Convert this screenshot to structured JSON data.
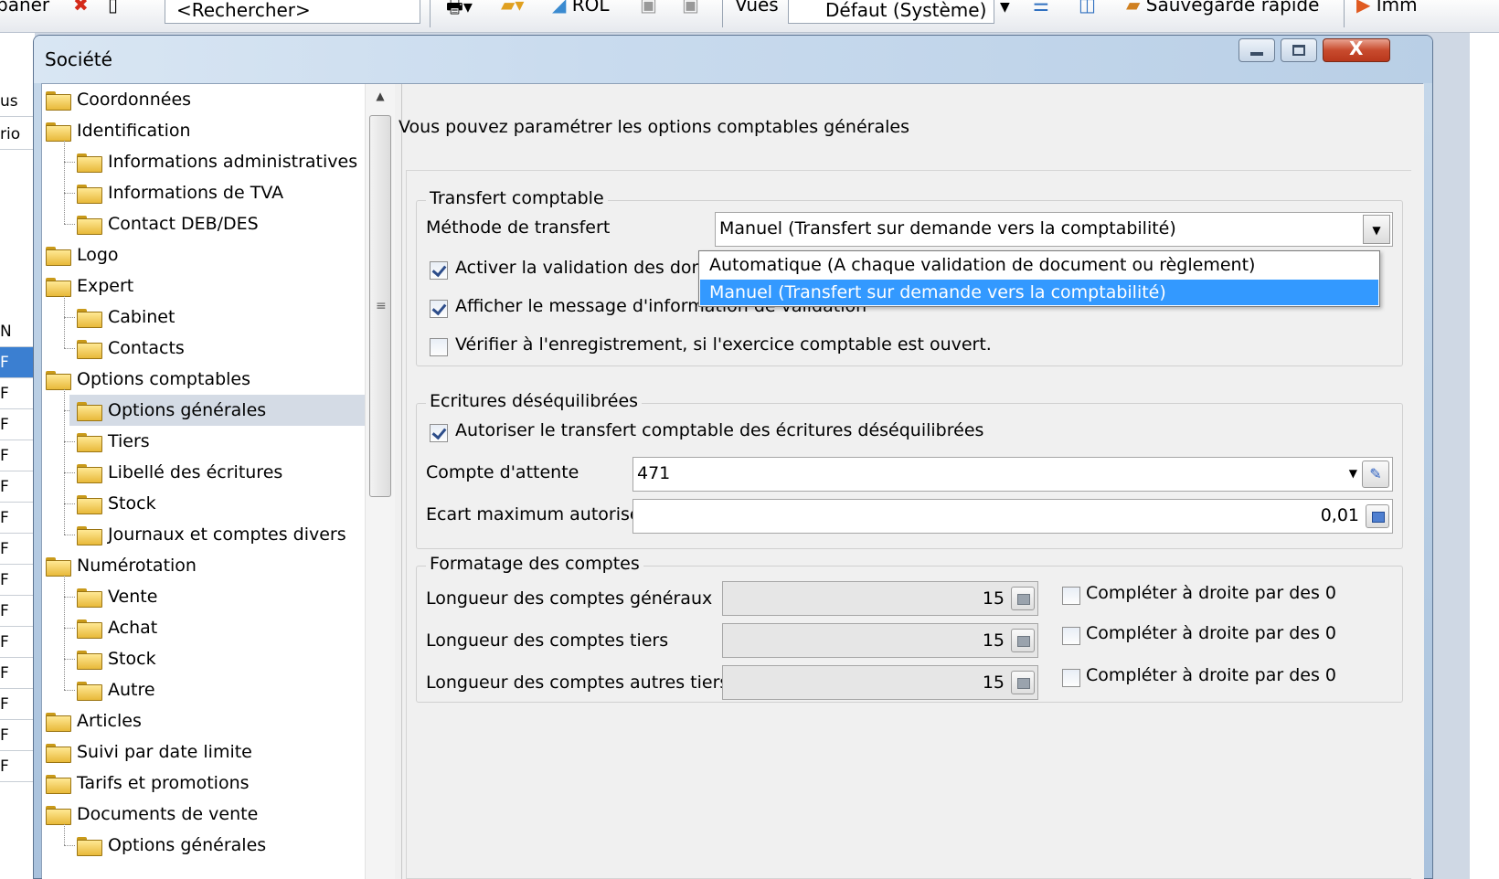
{
  "app_toolbar": {
    "frag_left": "baner",
    "search_placeholder": "<Rechercher>",
    "rol_label": "ROL",
    "views_label": "Vues",
    "views_value": "Défaut (Système)",
    "quick_save": "Sauvegarde rapide",
    "frag_right": "Imm"
  },
  "background": {
    "left_frags": [
      "us",
      "rio",
      "N",
      "F",
      "F",
      "F",
      "F",
      "F",
      "F",
      "F",
      "F",
      "F",
      "F",
      "F",
      "F",
      "F",
      "F"
    ]
  },
  "dialog": {
    "title": "Société",
    "tree": [
      {
        "label": "Coordonnées",
        "level": 0
      },
      {
        "label": "Identification",
        "level": 0
      },
      {
        "label": "Informations administratives",
        "level": 1
      },
      {
        "label": "Informations de TVA",
        "level": 1
      },
      {
        "label": "Contact DEB/DES",
        "level": 1
      },
      {
        "label": "Logo",
        "level": 0
      },
      {
        "label": "Expert",
        "level": 0
      },
      {
        "label": "Cabinet",
        "level": 1
      },
      {
        "label": "Contacts",
        "level": 1
      },
      {
        "label": "Options comptables",
        "level": 0
      },
      {
        "label": "Options générales",
        "level": 1,
        "selected": true
      },
      {
        "label": "Tiers",
        "level": 1
      },
      {
        "label": "Libellé des écritures",
        "level": 1
      },
      {
        "label": "Stock",
        "level": 1
      },
      {
        "label": "Journaux et comptes divers",
        "level": 1
      },
      {
        "label": "Numérotation",
        "level": 0
      },
      {
        "label": "Vente",
        "level": 1
      },
      {
        "label": "Achat",
        "level": 1
      },
      {
        "label": "Stock",
        "level": 1
      },
      {
        "label": "Autre",
        "level": 1
      },
      {
        "label": "Articles",
        "level": 0
      },
      {
        "label": "Suivi par date limite",
        "level": 0
      },
      {
        "label": "Tarifs et promotions",
        "level": 0
      },
      {
        "label": "Documents de vente",
        "level": 0
      },
      {
        "label": "Options générales",
        "level": 1
      }
    ],
    "intro": "Vous pouvez paramétrer les options comptables générales",
    "transfert": {
      "title": "Transfert comptable",
      "method_label": "Méthode de transfert",
      "method_value": "Manuel (Transfert sur demande vers la comptabilité)",
      "options": [
        "Automatique (A chaque validation de document ou règlement)",
        "Manuel (Transfert sur demande vers la comptabilité)"
      ],
      "chk_validation": "Activer la validation des donnée",
      "chk_message": "Afficher le message d'information de validation",
      "chk_exercice": "Vérifier à l'enregistrement, si l'exercice comptable est ouvert."
    },
    "ecritures": {
      "title": "Ecritures déséquilibrées",
      "chk_autoriser": "Autoriser le transfert comptable des écritures déséquilibrées",
      "compte_label": "Compte d'attente",
      "compte_value": "471",
      "ecart_label": "Ecart maximum autorisé",
      "ecart_value": "0,01"
    },
    "formatage": {
      "title": "Formatage des comptes",
      "rows": [
        {
          "label": "Longueur des comptes généraux",
          "value": "15",
          "chk": "Compléter à droite par des 0"
        },
        {
          "label": "Longueur des comptes tiers",
          "value": "15",
          "chk": "Compléter à droite par des 0"
        },
        {
          "label": "Longueur des comptes autres tiers",
          "value": "15",
          "chk": "Compléter à droite par des 0"
        }
      ]
    }
  }
}
